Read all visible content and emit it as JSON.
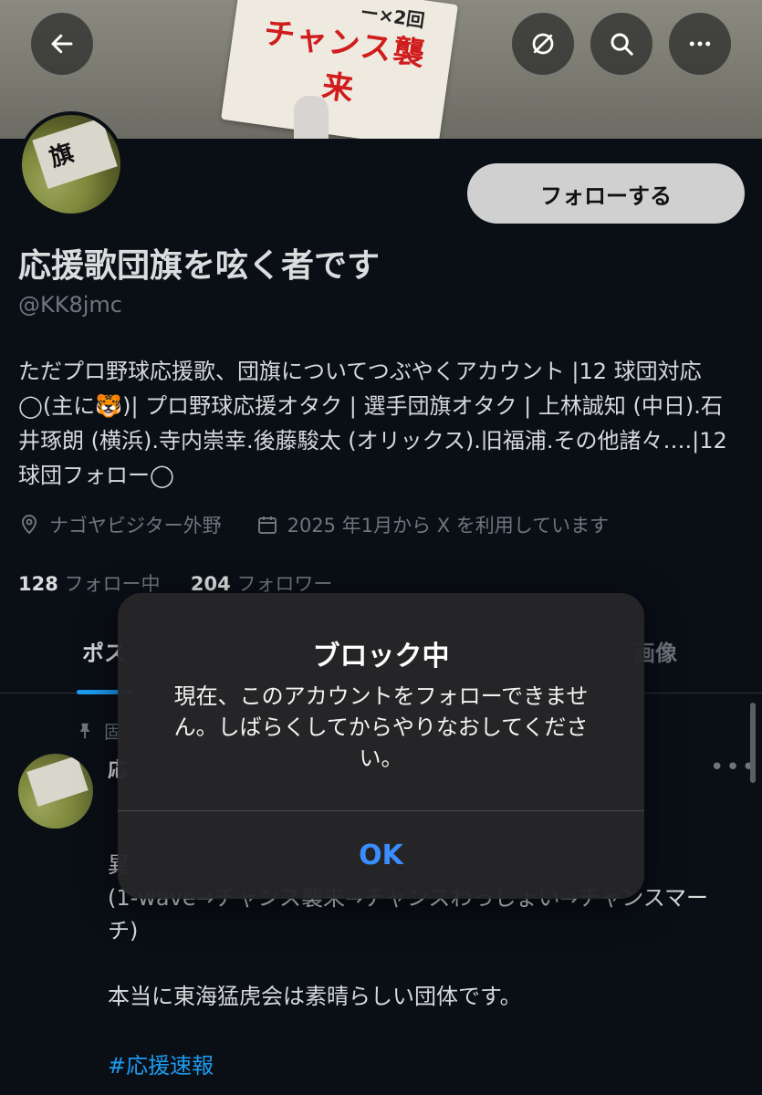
{
  "banner": {
    "sign_top": "ー×2回",
    "sign_text": "チャンス襲来"
  },
  "profile": {
    "display_name": "応援歌団旗を呟く者です",
    "handle": "@KK8jmc",
    "follow_label": "フォローする",
    "bio": "ただプロ野球応援歌、団旗についてつぶやくアカウント |12 球団対応◯(主に🐯)| プロ野球応援オタク | 選手団旗オタク | 上林誠知 (中日).石井琢朗 (横浜).寺内崇幸.後藤駿太 (オリックス).旧福浦.その他諸々….|12 球団フォロー◯",
    "location": "ナゴヤビジター外野",
    "joined": "2025 年1月から X を利用しています",
    "following_count": "128",
    "following_label": "フォロー中",
    "followers_count": "204",
    "followers_label": "フォロワー"
  },
  "tabs": [
    {
      "label": "ポス"
    },
    {
      "label": "画像"
    }
  ],
  "post": {
    "pinned_label": "固",
    "name_partial": "応",
    "line1": "異",
    "line2": "(1-wave→チャンス襲来→チャンスわっしょい→チャンスマーチ)",
    "line3": "本当に東海猛虎会は素晴らしい団体です。",
    "hashtag": "#応援速報",
    "more": "•••"
  },
  "alert": {
    "title": "ブロック中",
    "message": "現在、このアカウントをフォローできません。しばらくしてからやりなおしてください。",
    "ok_label": "OK"
  },
  "colors": {
    "accent": "#1d9bf0",
    "alert_ok": "#3a8dff",
    "background": "#0a0f16"
  },
  "icons": {
    "back": "arrow-left-icon",
    "mute": "slash-circle-icon",
    "search": "search-icon",
    "more": "more-horizontal-icon",
    "location": "location-pin-icon",
    "calendar": "calendar-icon",
    "pin": "pin-icon"
  }
}
